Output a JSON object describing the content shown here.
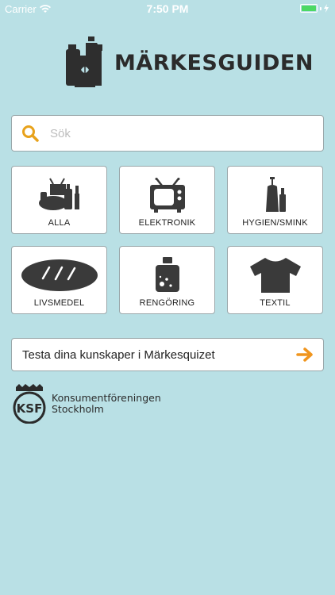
{
  "status_bar": {
    "carrier": "Carrier",
    "time": "7:50 PM",
    "battery_color": "#4cd964"
  },
  "header": {
    "title": "MÄRKESGUIDEN",
    "logo_icon": "product-bottles-icon"
  },
  "search": {
    "placeholder": "Sök",
    "value": "",
    "icon": "search-icon",
    "icon_color": "#e8a21b"
  },
  "categories": [
    {
      "label": "ALLA",
      "icon": "all-products-icon"
    },
    {
      "label": "ELEKTRONIK",
      "icon": "tv-icon"
    },
    {
      "label": "HYGIEN/SMINK",
      "icon": "cosmetics-icon"
    },
    {
      "label": "LIVSMEDEL",
      "icon": "bread-icon"
    },
    {
      "label": "RENGÖRING",
      "icon": "detergent-bottle-icon"
    },
    {
      "label": "TEXTIL",
      "icon": "tshirt-icon"
    }
  ],
  "quiz": {
    "label": "Testa dina kunskaper i Märkesquizet",
    "icon": "arrow-right-icon",
    "icon_color": "#f0951e"
  },
  "organization": {
    "line1": "Konsumentföreningen",
    "line2": "Stockholm",
    "logo_text": "KSF"
  },
  "colors": {
    "background": "#b9e0e5",
    "icon_dark": "#3a3a3a"
  }
}
